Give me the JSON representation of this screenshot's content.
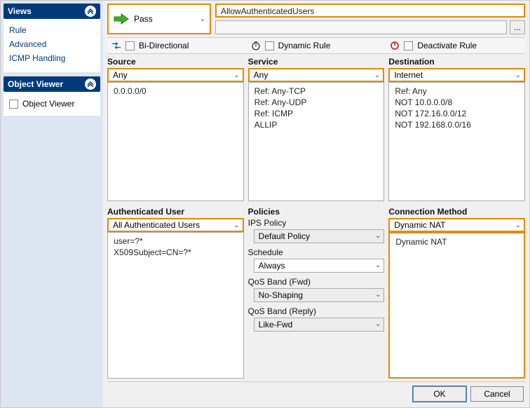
{
  "sidebar": {
    "views": {
      "title": "Views",
      "items": [
        "Rule",
        "Advanced",
        "ICMP Handling"
      ]
    },
    "objectViewer": {
      "title": "Object Viewer",
      "checkbox": "Object Viewer"
    }
  },
  "action": {
    "label": "Pass"
  },
  "ruleName": "AllowAuthenticatedUsers",
  "flags": {
    "bidir": "Bi-Directional",
    "dynamic": "Dynamic Rule",
    "deactivate": "Deactivate Rule"
  },
  "source": {
    "label": "Source",
    "selected": "Any",
    "items": [
      "0.0.0.0/0"
    ]
  },
  "service": {
    "label": "Service",
    "selected": "Any",
    "items": [
      "Ref: Any-TCP",
      "Ref: Any-UDP",
      "Ref: ICMP",
      "ALLIP"
    ]
  },
  "destination": {
    "label": "Destination",
    "selected": "Internet",
    "items": [
      "Ref: Any",
      "NOT 10.0.0.0/8",
      "NOT 172.16.0.0/12",
      "NOT 192.168.0.0/16"
    ]
  },
  "authUser": {
    "label": "Authenticated User",
    "selected": "All Authenticated Users",
    "items": [
      "user=?*",
      "X509Subject=CN=?*"
    ]
  },
  "policies": {
    "label": "Policies",
    "ips": {
      "label": "IPS Policy",
      "value": "Default Policy"
    },
    "schedule": {
      "label": "Schedule",
      "value": "Always"
    },
    "qosFwd": {
      "label": "QoS Band (Fwd)",
      "value": "No-Shaping"
    },
    "qosReply": {
      "label": "QoS Band (Reply)",
      "value": "Like-Fwd"
    }
  },
  "connMethod": {
    "label": "Connection Method",
    "selected": "Dynamic NAT",
    "items": [
      "Dynamic NAT"
    ]
  },
  "buttons": {
    "ok": "OK",
    "cancel": "Cancel"
  }
}
